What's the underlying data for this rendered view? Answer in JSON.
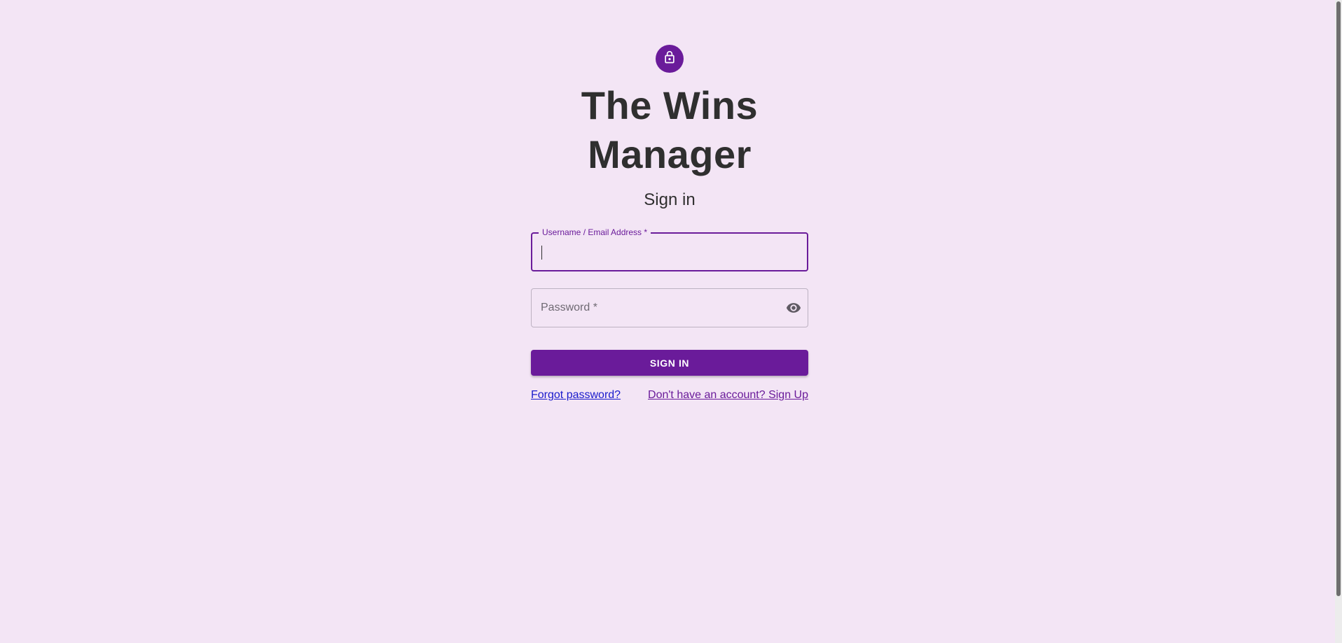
{
  "app": {
    "title": "The Wins Manager"
  },
  "form": {
    "heading": "Sign in",
    "username": {
      "label": "Username / Email Address *",
      "value": ""
    },
    "password": {
      "label": "Password *",
      "value": ""
    },
    "submit_label": "SIGN IN"
  },
  "links": {
    "forgot_password": "Forgot password?",
    "sign_up": "Don't have an account? Sign Up"
  },
  "icons": {
    "avatar": "lock-icon",
    "password_toggle": "eye-icon"
  },
  "colors": {
    "background": "#f3e5f5",
    "primary": "#6a1b9a",
    "text": "#2f2f2f",
    "link": "#1a1acc"
  }
}
